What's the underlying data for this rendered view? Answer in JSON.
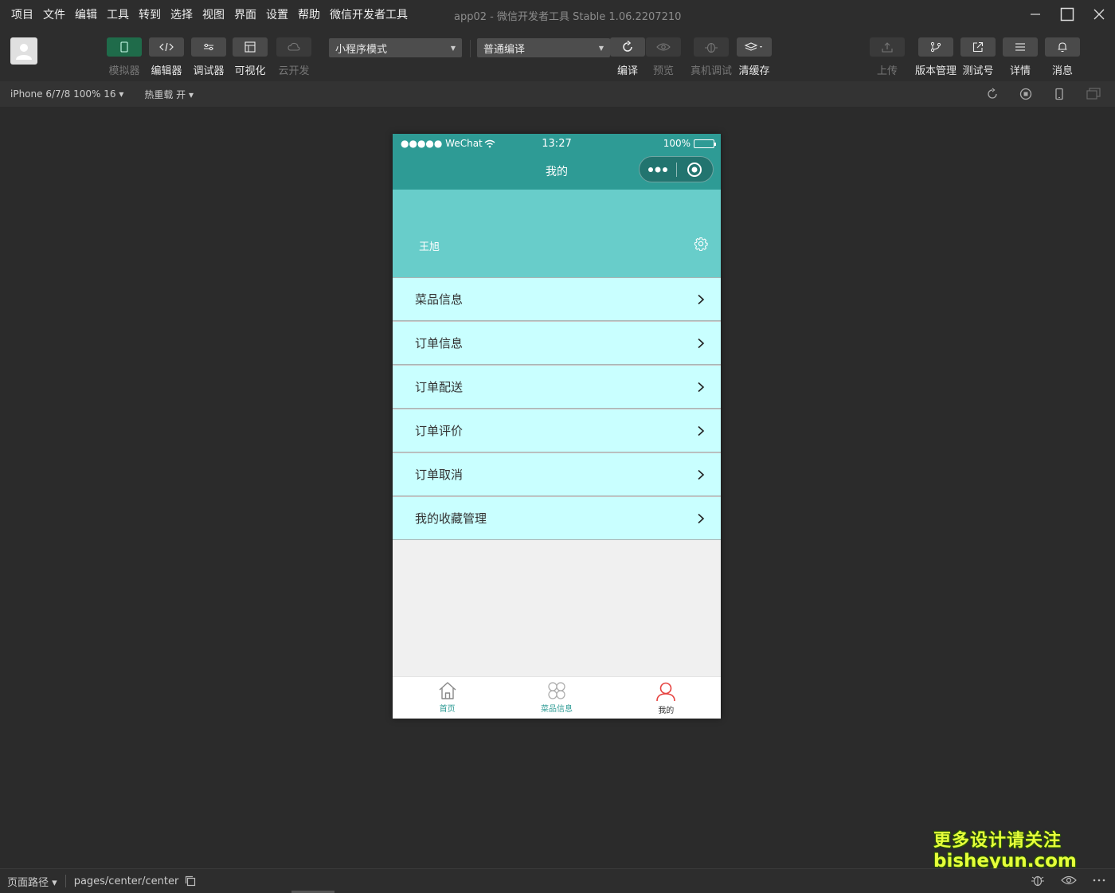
{
  "menubar": {
    "items": [
      "项目",
      "文件",
      "编辑",
      "工具",
      "转到",
      "选择",
      "视图",
      "界面",
      "设置",
      "帮助",
      "微信开发者工具"
    ],
    "title": "app02 - 微信开发者工具 Stable 1.06.2207210"
  },
  "toolbar": {
    "left_tools": [
      {
        "label": "模拟器",
        "icon": "phone-icon",
        "active": true,
        "enabled": false
      },
      {
        "label": "编辑器",
        "icon": "code-icon",
        "active": false,
        "enabled": true
      },
      {
        "label": "调试器",
        "icon": "sliders-icon",
        "active": false,
        "enabled": true
      },
      {
        "label": "可视化",
        "icon": "layout-icon",
        "active": false,
        "enabled": true
      },
      {
        "label": "云开发",
        "icon": "cloud-icon",
        "active": false,
        "enabled": false
      }
    ],
    "mode_select": "小程序模式",
    "compile_select": "普通编译",
    "compile_tools": [
      {
        "label": "编译",
        "icon": "refresh-icon",
        "enabled": true
      },
      {
        "label": "预览",
        "icon": "eye-icon",
        "enabled": false
      },
      {
        "label": "真机调试",
        "icon": "bug-icon",
        "enabled": false
      },
      {
        "label": "清缓存",
        "icon": "layers-icon",
        "enabled": true
      }
    ],
    "right_tools": [
      {
        "label": "上传",
        "icon": "upload-icon",
        "enabled": false
      },
      {
        "label": "版本管理",
        "icon": "branch-icon",
        "enabled": true
      },
      {
        "label": "测试号",
        "icon": "external-link-icon",
        "enabled": true
      },
      {
        "label": "详情",
        "icon": "menu-icon",
        "enabled": true
      },
      {
        "label": "消息",
        "icon": "bell-icon",
        "enabled": true
      }
    ]
  },
  "subbar": {
    "device": "iPhone 6/7/8 100% 16",
    "hot_reload": "热重载 开"
  },
  "phone": {
    "status": {
      "carrier": "●●●●● WeChat",
      "time": "13:27",
      "battery": "100%"
    },
    "nav_title": "我的",
    "username": "王旭",
    "menu": [
      "菜品信息",
      "订单信息",
      "订单配送",
      "订单评价",
      "订单取消",
      "我的收藏管理"
    ],
    "tabs": [
      {
        "label": "首页",
        "icon": "home-icon",
        "color": "#2e9b95"
      },
      {
        "label": "菜品信息",
        "icon": "grid-icon",
        "color": "#2e9b95"
      },
      {
        "label": "我的",
        "icon": "user-icon",
        "color": "#333333",
        "icon_color": "#e64340"
      }
    ]
  },
  "watermark": {
    "line1": "更多设计请关注",
    "line2": "bisheyun.com"
  },
  "bottombar": {
    "path_label": "页面路径",
    "path": "pages/center/center"
  }
}
